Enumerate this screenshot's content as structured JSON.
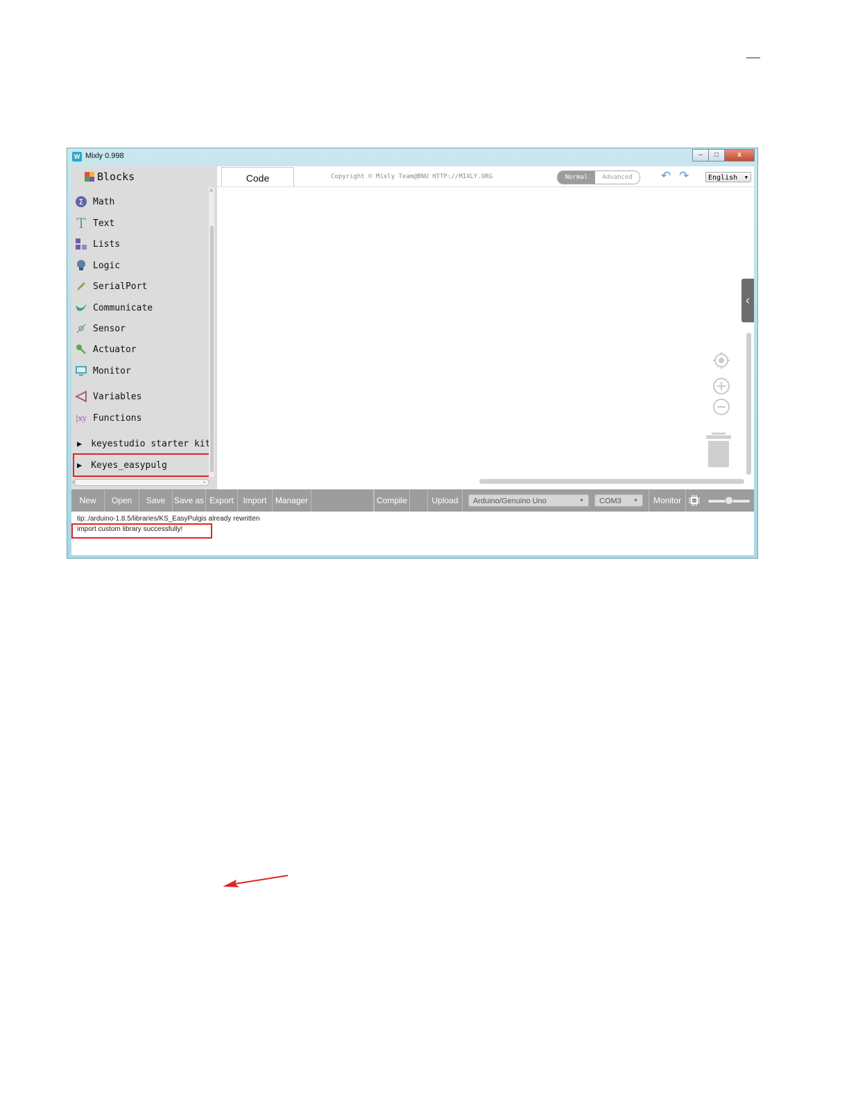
{
  "window": {
    "title": "Mixly 0.998",
    "app_icon_text": "W",
    "controls": {
      "minimize": "–",
      "maximize": "□",
      "close": "x"
    }
  },
  "sidebar": {
    "heading": "Blocks",
    "categories": [
      {
        "label": "Math",
        "icon": "sigma-icon",
        "color": "#5b67a5"
      },
      {
        "label": "Text",
        "icon": "text-t-icon",
        "color": "#5ba58c"
      },
      {
        "label": "Lists",
        "icon": "lists-blocks-icon",
        "color": "#745ba5"
      },
      {
        "label": "Logic",
        "icon": "lightbulb-icon",
        "color": "#5b80a5"
      },
      {
        "label": "SerialPort",
        "icon": "pen-icon",
        "color": "#8ba04c"
      },
      {
        "label": "Communicate",
        "icon": "bird-icon",
        "color": "#3aa28b"
      },
      {
        "label": "Sensor",
        "icon": "satellite-icon",
        "color": "#7a9a8a"
      },
      {
        "label": "Actuator",
        "icon": "key-icon",
        "color": "#5aa84a"
      },
      {
        "label": "Monitor",
        "icon": "monitor-icon",
        "color": "#4fa3b5"
      },
      {
        "label": "Variables",
        "icon": "variable-icon",
        "color": "#a55b80"
      },
      {
        "label": "Functions",
        "icon": "function-xy-icon",
        "color": "#995ba5"
      },
      {
        "label": "keyestudio starter kit",
        "icon": "expand-triangle-icon"
      },
      {
        "label": "Keyes_easypulg",
        "icon": "expand-triangle-icon"
      }
    ]
  },
  "header": {
    "code_tab": "Code",
    "copyright": "Copyright © Mixly Team@BNU HTTP://MIXLY.ORG",
    "mode_normal": "Normal",
    "mode_advanced": "Advanced",
    "language": "English"
  },
  "toolbar": {
    "new": "New",
    "open": "Open",
    "save": "Save",
    "save_as": "Save as",
    "export": "Export",
    "import": "Import",
    "manager": "Manager",
    "compile": "Compile",
    "upload": "Upload",
    "board": "Arduino/Genuino Uno",
    "port": "COM3",
    "monitor": "Monitor"
  },
  "console": {
    "line1": "tip:./arduino-1.8.5/libraries/KS_EasyPulgis already rewritten",
    "line2": "import custom library successfully!"
  },
  "annotation_color": "#e02424"
}
